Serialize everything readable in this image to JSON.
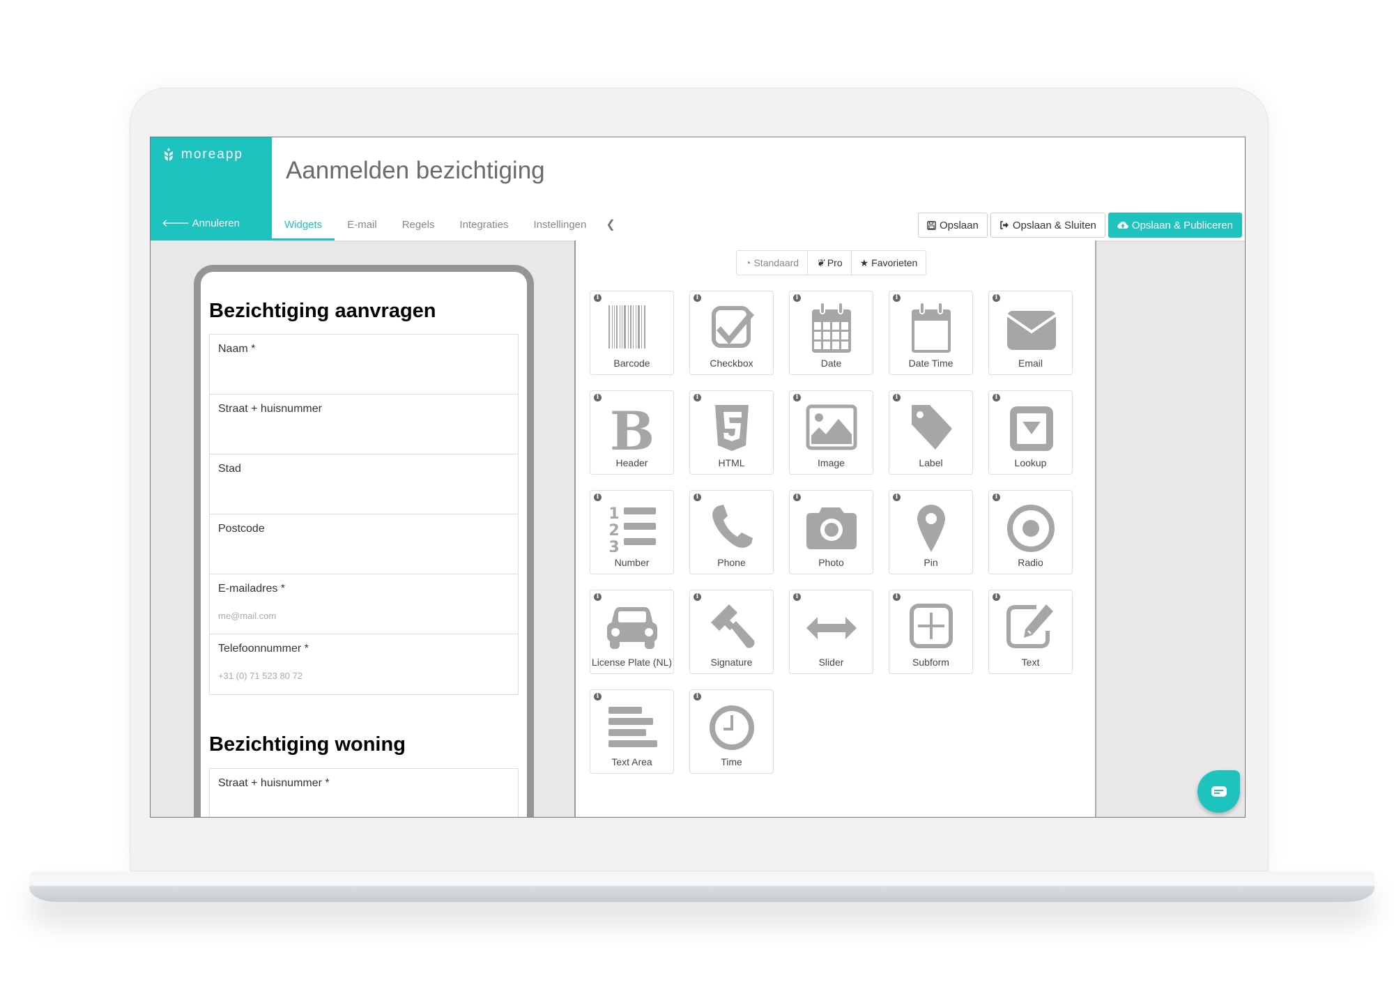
{
  "app": {
    "logo_text": "moreapp",
    "cancel_label": "Annuleren",
    "title": "Aanmelden bezichtiging"
  },
  "tabs": [
    {
      "label": "Widgets",
      "active": true
    },
    {
      "label": "E-mail"
    },
    {
      "label": "Regels"
    },
    {
      "label": "Integraties"
    },
    {
      "label": "Instellingen"
    }
  ],
  "actions": {
    "save": "Opslaan",
    "save_close": "Opslaan & Sluiten",
    "save_publish": "Opslaan & Publiceren"
  },
  "colors": {
    "accent": "#1ec3c0",
    "icon_gray": "#a6a6a6"
  },
  "preview": {
    "section1_title": "Bezichtiging aanvragen",
    "fields1": [
      {
        "label": "Naam *",
        "placeholder": ""
      },
      {
        "label": "Straat + huisnummer",
        "placeholder": ""
      },
      {
        "label": "Stad",
        "placeholder": ""
      },
      {
        "label": "Postcode",
        "placeholder": ""
      },
      {
        "label": "E-mailadres *",
        "placeholder": "me@mail.com"
      },
      {
        "label": "Telefoonnummer *",
        "placeholder": "+31 (0) 71 523 80 72"
      }
    ],
    "section2_title": "Bezichtiging woning",
    "fields2": [
      {
        "label": "Straat + huisnummer *"
      }
    ]
  },
  "widget_filters": {
    "standard": "Standaard",
    "pro": "Pro",
    "favorites": "Favorieten"
  },
  "widgets": [
    {
      "label": "Barcode",
      "icon": "barcode"
    },
    {
      "label": "Checkbox",
      "icon": "checkbox"
    },
    {
      "label": "Date",
      "icon": "calendar"
    },
    {
      "label": "Date Time",
      "icon": "calendar-empty"
    },
    {
      "label": "Email",
      "icon": "envelope"
    },
    {
      "label": "Header",
      "icon": "bold"
    },
    {
      "label": "HTML",
      "icon": "html5"
    },
    {
      "label": "Image",
      "icon": "picture"
    },
    {
      "label": "Label",
      "icon": "tag"
    },
    {
      "label": "Lookup",
      "icon": "dropdown"
    },
    {
      "label": "Number",
      "icon": "ordered-list"
    },
    {
      "label": "Phone",
      "icon": "phone"
    },
    {
      "label": "Photo",
      "icon": "camera"
    },
    {
      "label": "Pin",
      "icon": "map-marker"
    },
    {
      "label": "Radio",
      "icon": "radio"
    },
    {
      "label": "License Plate (NL)",
      "icon": "car"
    },
    {
      "label": "Signature",
      "icon": "gavel"
    },
    {
      "label": "Slider",
      "icon": "arrows-h"
    },
    {
      "label": "Subform",
      "icon": "plus-square"
    },
    {
      "label": "Text",
      "icon": "edit"
    },
    {
      "label": "Text Area",
      "icon": "text-lines"
    },
    {
      "label": "Time",
      "icon": "clock"
    }
  ],
  "info_glyph": "i"
}
